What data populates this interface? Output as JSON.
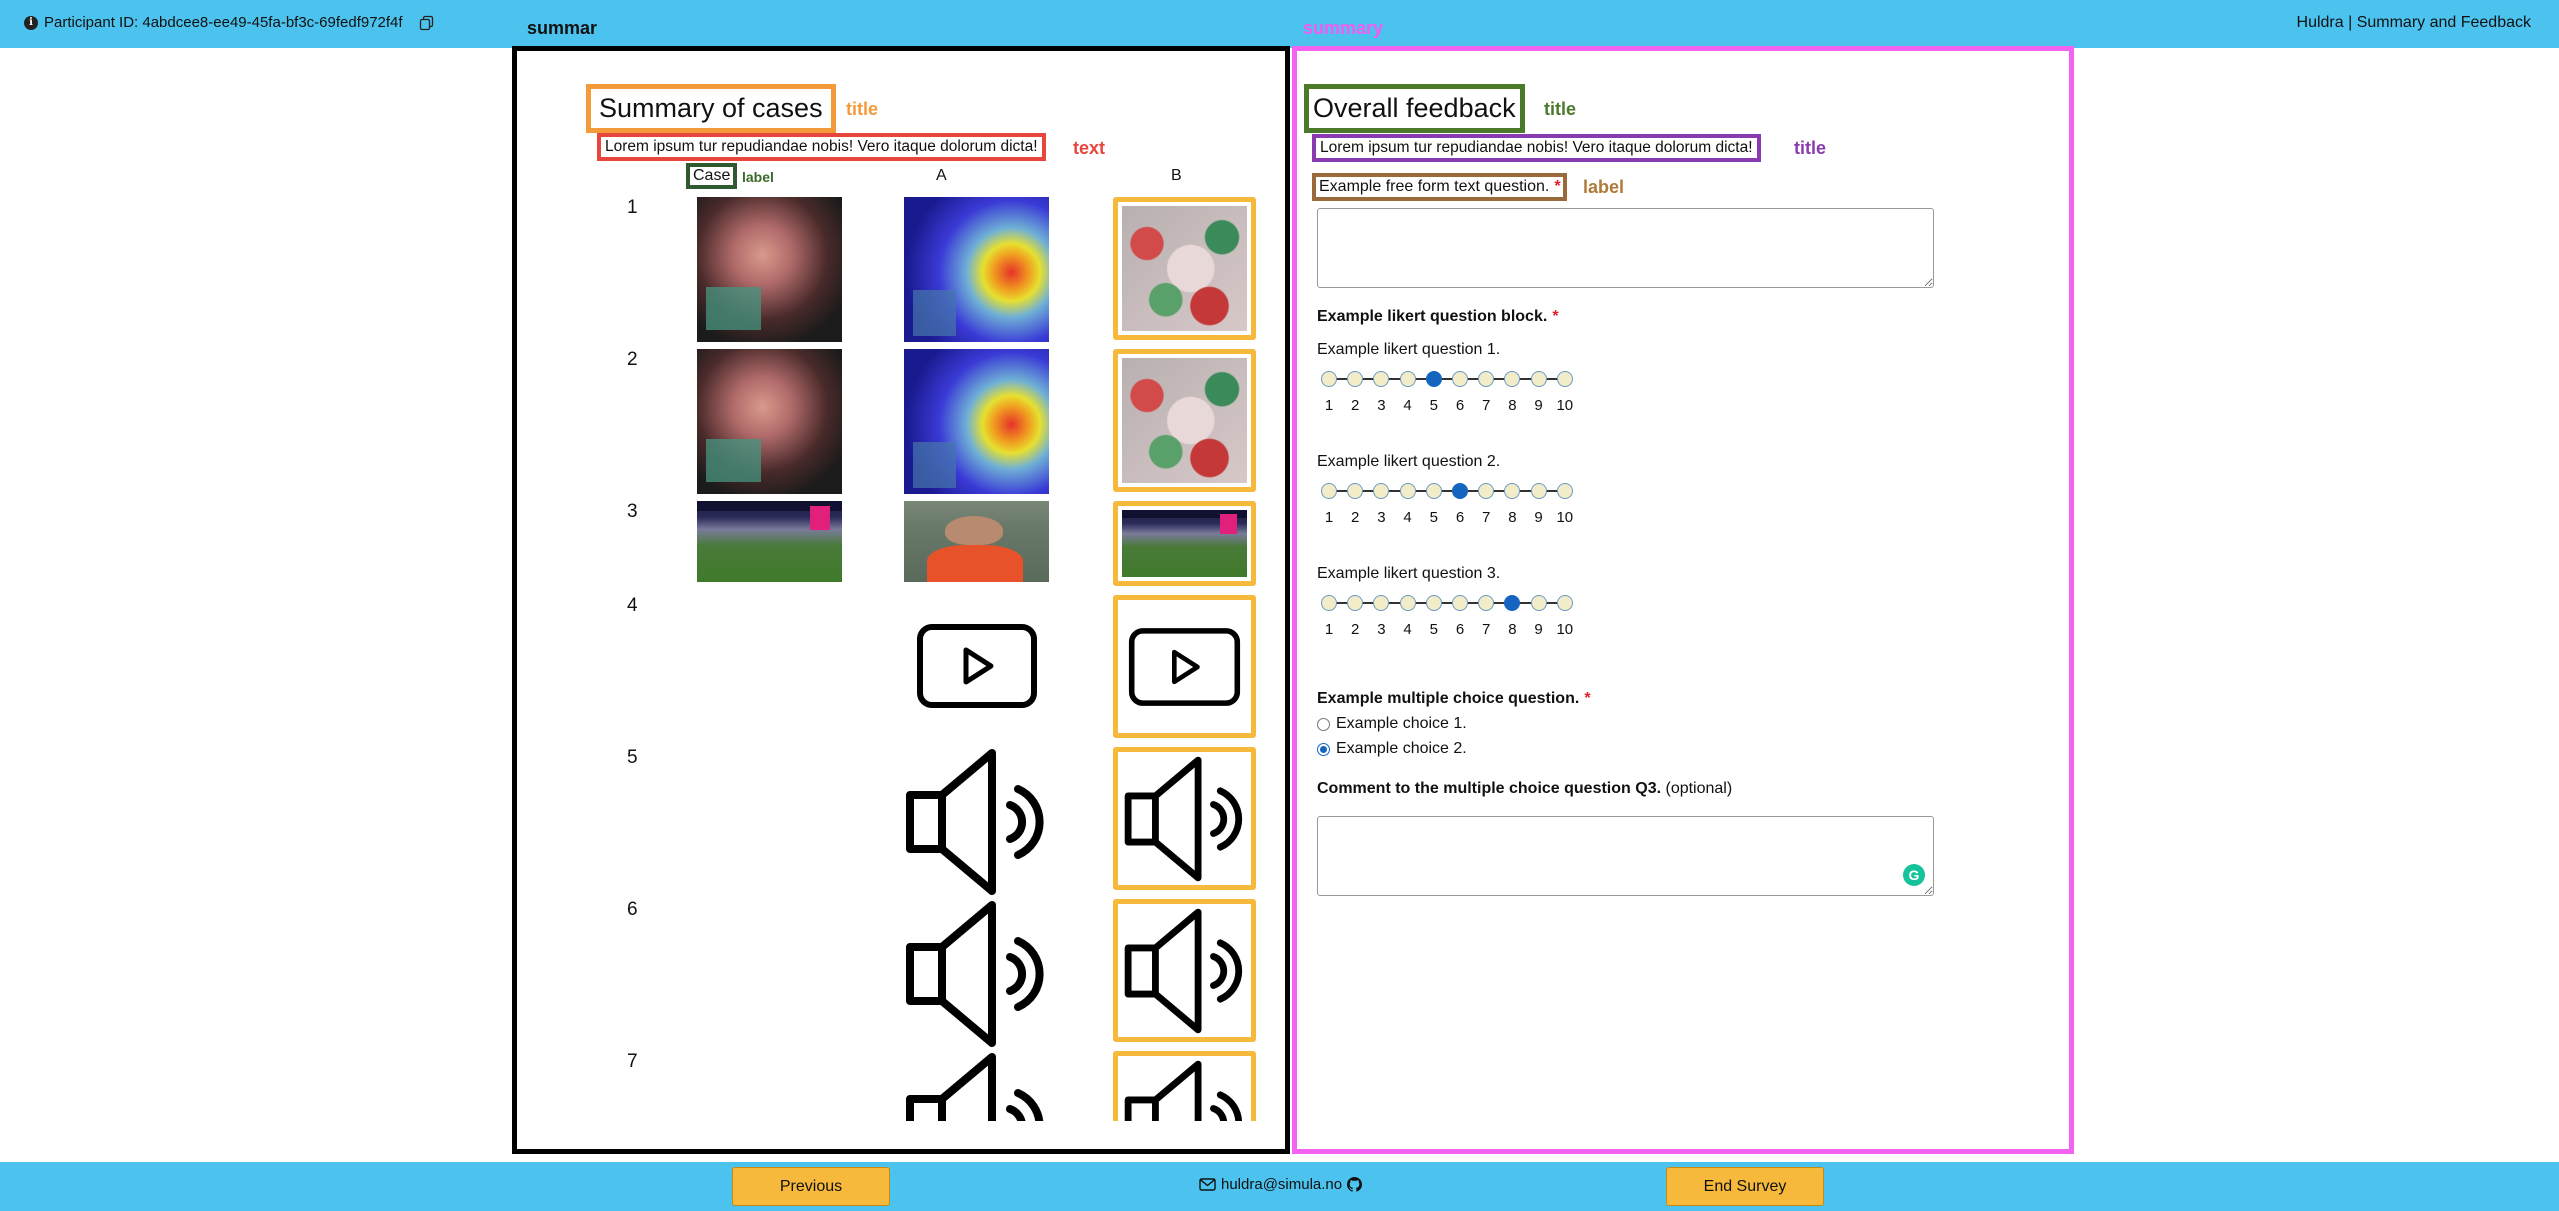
{
  "header": {
    "participant_label": "Participant ID: 4abdcee8-ee49-45fa-bf3c-69fedf972f4f",
    "app_title": "Huldra | Summary and Feedback"
  },
  "annotations": {
    "left_panel_label": "summar",
    "right_panel_label": "summary",
    "summary_title_tag": "title",
    "summary_text_tag": "text",
    "case_label_tag": "label",
    "feedback_title_tag": "title",
    "feedback_text_tag": "title",
    "freeform_label_tag": "label",
    "colors": {
      "black": "#000000",
      "magenta": "#f263f2",
      "orange": "#f39a3a",
      "red": "#e8453c",
      "dark_green": "#2f5a2f",
      "olive_green": "#4a7a2a",
      "purple": "#8a3ab0",
      "brown": "#9a6a3a",
      "highlight": "#f6b93b"
    }
  },
  "summary": {
    "title": "Summary of cases",
    "text": "Lorem ipsum tur repudiandae nobis! Vero itaque dolorum dicta!",
    "col_case": "Case",
    "col_a": "A",
    "col_b": "B",
    "rows": [
      {
        "num": "1",
        "type": "image",
        "a": "blurred-face-image",
        "b": "heatmap-image",
        "c": "mosaic-image",
        "highlighted": "B"
      },
      {
        "num": "2",
        "type": "image",
        "a": "blurred-face-image",
        "b": "heatmap-image",
        "c": "mosaic-image",
        "highlighted": "B"
      },
      {
        "num": "3",
        "type": "image",
        "a": "football-match-image",
        "b": "football-player-image",
        "c": "football-match-image",
        "highlighted": "B"
      },
      {
        "num": "4",
        "type": "video",
        "a": "",
        "b": "video-play-icon",
        "c": "video-play-icon",
        "highlighted": "B"
      },
      {
        "num": "5",
        "type": "audio",
        "a": "",
        "b": "speaker-icon",
        "c": "speaker-icon",
        "highlighted": "B"
      },
      {
        "num": "6",
        "type": "audio",
        "a": "",
        "b": "speaker-icon",
        "c": "speaker-icon",
        "highlighted": "B"
      },
      {
        "num": "7",
        "type": "audio",
        "a": "",
        "b": "speaker-icon",
        "c": "speaker-icon",
        "highlighted": "B"
      }
    ]
  },
  "feedback": {
    "title": "Overall feedback",
    "text": "Lorem ipsum tur repudiandae nobis! Vero itaque dolorum dicta!",
    "freeform_label": "Example free form text question.",
    "required_mark": "*",
    "likert_block_label": "Example likert question block.",
    "likert": [
      {
        "label": "Example likert question 1.",
        "selected": 5
      },
      {
        "label": "Example likert question 2.",
        "selected": 6
      },
      {
        "label": "Example likert question 3.",
        "selected": 8
      }
    ],
    "scale": [
      "1",
      "2",
      "3",
      "4",
      "5",
      "6",
      "7",
      "8",
      "9",
      "10"
    ],
    "mc_label": "Example multiple choice question.",
    "mc_choices": [
      {
        "label": "Example choice 1.",
        "checked": false
      },
      {
        "label": "Example choice 2.",
        "checked": true
      }
    ],
    "comment_label": "Comment to the multiple choice question Q3.",
    "comment_optional": "(optional)",
    "grammarly_glyph": "G"
  },
  "footer": {
    "previous_label": "Previous",
    "email": "huldra@simula.no",
    "end_label": "End Survey",
    "icons": [
      "mail-icon",
      "github-icon"
    ]
  }
}
